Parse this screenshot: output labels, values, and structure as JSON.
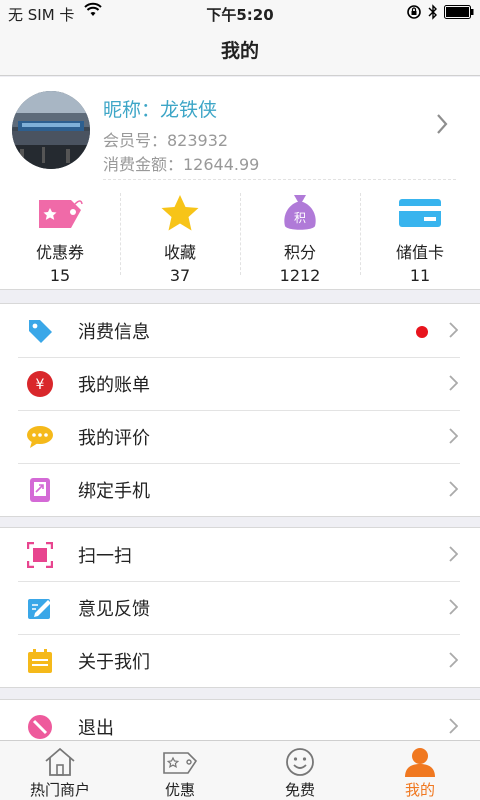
{
  "status_bar": {
    "carrier": "无 SIM 卡",
    "time": "下午5:20"
  },
  "nav": {
    "title": "我的"
  },
  "profile": {
    "nickname": "昵称：龙铁侠",
    "member_no": "会员号：823932",
    "spend": "消费金额：12644.99"
  },
  "stats": [
    {
      "label": "优惠券",
      "value": "15",
      "icon": "coupon-icon",
      "color": "#f06aa8"
    },
    {
      "label": "收藏",
      "value": "37",
      "icon": "star-icon",
      "color": "#f7c418"
    },
    {
      "label": "积分",
      "value": "1212",
      "icon": "points-bag-icon",
      "color": "#b07ad8"
    },
    {
      "label": "储值卡",
      "value": "11",
      "icon": "stored-card-icon",
      "color": "#38b4ee"
    }
  ],
  "menu_group1": [
    {
      "label": "消费信息",
      "icon": "tag-icon",
      "color": "#3aa7e8",
      "badge": "red-dot"
    },
    {
      "label": "我的账单",
      "icon": "yen-icon",
      "color": "#d9272b"
    },
    {
      "label": "我的评价",
      "icon": "comment-icon",
      "color": "#f5b91a"
    },
    {
      "label": "绑定手机",
      "icon": "phone-icon",
      "color": "#d46ad6"
    }
  ],
  "menu_group2": [
    {
      "label": "扫一扫",
      "icon": "scan-icon",
      "color": "#e8458f"
    },
    {
      "label": "意见反馈",
      "icon": "feedback-icon",
      "color": "#3aa7e8"
    },
    {
      "label": "关于我们",
      "icon": "about-icon",
      "color": "#f5b91a"
    }
  ],
  "menu_group3": [
    {
      "label": "退出",
      "icon": "logout-icon",
      "color": "#ee5a9c"
    }
  ],
  "tabs": [
    {
      "label": "热门商户",
      "icon": "home-icon"
    },
    {
      "label": "优惠",
      "icon": "coupon-tab-icon"
    },
    {
      "label": "免费",
      "icon": "smiley-icon"
    },
    {
      "label": "我的",
      "icon": "user-icon",
      "active": true
    }
  ],
  "colors": {
    "accent": "#f07820",
    "nickname": "#3ea6c7"
  }
}
